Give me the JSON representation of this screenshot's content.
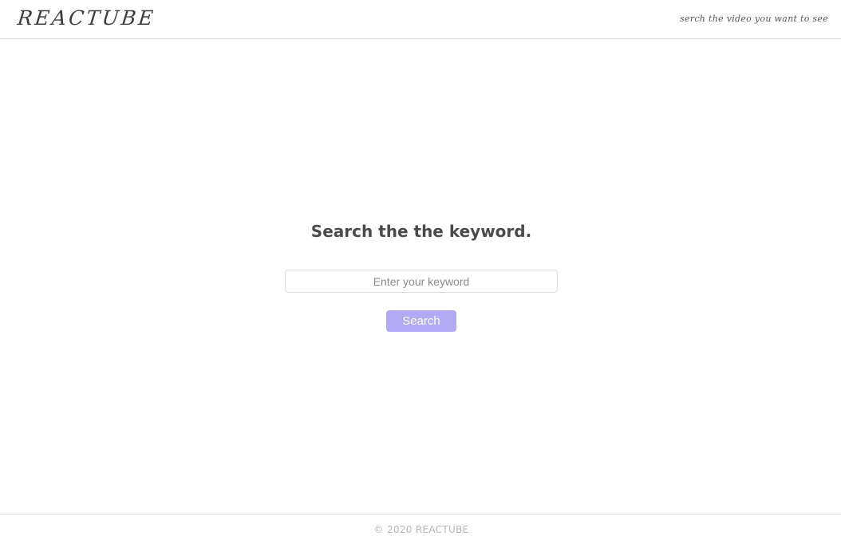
{
  "header": {
    "logo": "REACTUBE",
    "tagline": "serch the video you want to see"
  },
  "main": {
    "heading": "Search the the keyword.",
    "search": {
      "placeholder": "Enter your keyword",
      "value": ""
    },
    "search_button_label": "Search"
  },
  "footer": {
    "copyright": "© 2020 REACTUBE"
  },
  "colors": {
    "accent": "#b3aaf5",
    "text": "#4a4a4a",
    "border": "#dcdcdc"
  }
}
